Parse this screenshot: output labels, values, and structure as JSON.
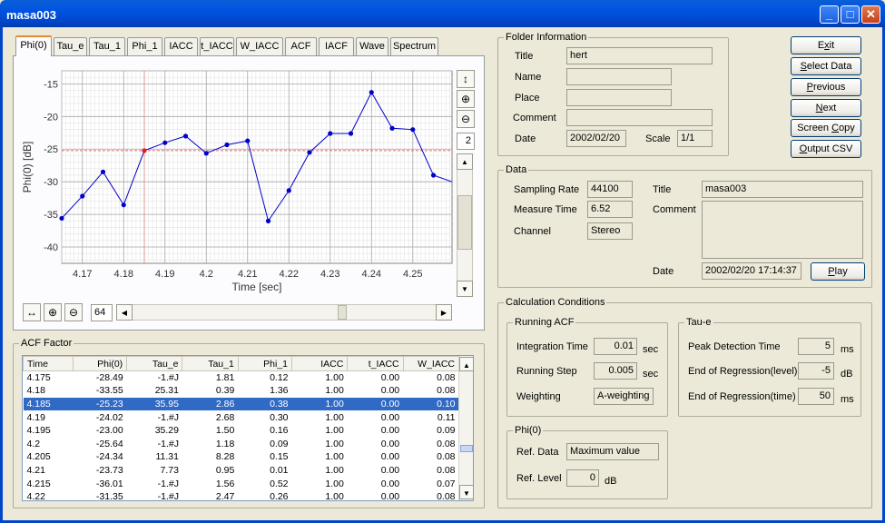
{
  "window": {
    "title": "masa003",
    "min_icon": "minimize-icon",
    "max_icon": "maximize-icon",
    "close_icon": "close-icon"
  },
  "tabs": [
    "Phi(0)",
    "Tau_e",
    "Tau_1",
    "Phi_1",
    "IACC",
    "t_IACC",
    "W_IACC",
    "ACF",
    "IACF",
    "Wave",
    "Spectrum"
  ],
  "active_tab": "Phi(0)",
  "chart_toolbar": {
    "value": "2",
    "zoom_value": "64"
  },
  "chart_data": {
    "type": "line",
    "xlabel": "Time [sec]",
    "ylabel": "Phi(0) [dB]",
    "x_ticks": [
      "4.17",
      "4.18",
      "4.19",
      "4.2",
      "4.21",
      "4.22",
      "4.23",
      "4.24",
      "4.25"
    ],
    "y_ticks": [
      "-15",
      "-20",
      "-25",
      "-30",
      "-35",
      "-40"
    ],
    "xlim": [
      4.165,
      4.2595
    ],
    "ylim": [
      -42.5,
      -13
    ],
    "grid": true,
    "reference_line": -25.23,
    "cursor_x": 4.185,
    "series": [
      {
        "color": "#0000C8",
        "x": [
          4.165,
          4.17,
          4.175,
          4.18,
          4.185,
          4.19,
          4.195,
          4.2,
          4.205,
          4.21,
          4.215,
          4.22,
          4.225,
          4.23,
          4.235,
          4.24,
          4.245,
          4.25,
          4.255,
          4.2595
        ],
        "y": [
          -35.6,
          -32.2,
          -28.49,
          -33.55,
          -25.23,
          -24.02,
          -23.0,
          -25.64,
          -24.34,
          -23.73,
          -36.01,
          -31.35,
          -25.5,
          -22.6,
          -22.6,
          -16.3,
          -21.8,
          -22.0,
          -29.0,
          -30.0
        ]
      }
    ],
    "highlight_index": 4
  },
  "acf_factor": {
    "title": "ACF Factor",
    "columns": [
      "Time",
      "Phi(0)",
      "Tau_e",
      "Tau_1",
      "Phi_1",
      "IACC",
      "t_IACC",
      "W_IACC"
    ],
    "rows": [
      [
        "4.175",
        "-28.49",
        "-1.#J",
        "1.81",
        "0.12",
        "1.00",
        "0.00",
        "0.08"
      ],
      [
        "4.18",
        "-33.55",
        "25.31",
        "0.39",
        "1.36",
        "1.00",
        "0.00",
        "0.08"
      ],
      [
        "4.185",
        "-25.23",
        "35.95",
        "2.86",
        "0.38",
        "1.00",
        "0.00",
        "0.10"
      ],
      [
        "4.19",
        "-24.02",
        "-1.#J",
        "2.68",
        "0.30",
        "1.00",
        "0.00",
        "0.11"
      ],
      [
        "4.195",
        "-23.00",
        "35.29",
        "1.50",
        "0.16",
        "1.00",
        "0.00",
        "0.09"
      ],
      [
        "4.2",
        "-25.64",
        "-1.#J",
        "1.18",
        "0.09",
        "1.00",
        "0.00",
        "0.08"
      ],
      [
        "4.205",
        "-24.34",
        "11.31",
        "8.28",
        "0.15",
        "1.00",
        "0.00",
        "0.08"
      ],
      [
        "4.21",
        "-23.73",
        "7.73",
        "0.95",
        "0.01",
        "1.00",
        "0.00",
        "0.08"
      ],
      [
        "4.215",
        "-36.01",
        "-1.#J",
        "1.56",
        "0.52",
        "1.00",
        "0.00",
        "0.07"
      ],
      [
        "4.22",
        "-31.35",
        "-1.#J",
        "2.47",
        "0.26",
        "1.00",
        "0.00",
        "0.08"
      ]
    ],
    "selected_row": 2
  },
  "folder_info": {
    "title": "Folder Information",
    "title_label": "Title",
    "title_value": "hert",
    "name_label": "Name",
    "name_value": "",
    "place_label": "Place",
    "place_value": "",
    "comment_label": "Comment",
    "comment_value": "",
    "date_label": "Date",
    "date_value": "2002/02/20",
    "scale_label": "Scale",
    "scale_value": "1/1"
  },
  "buttons": {
    "exit": "Exit",
    "select_data": "Select Data",
    "previous": "Previous",
    "next": "Next",
    "screen_copy": "Screen Copy",
    "output_csv": "Output CSV",
    "play": "Play"
  },
  "data": {
    "title": "Data",
    "sampling_rate_label": "Sampling Rate",
    "sampling_rate": "44100",
    "measure_time_label": "Measure Time",
    "measure_time": "6.52",
    "channel_label": "Channel",
    "channel": "Stereo",
    "title_label": "Title",
    "title_value": "masa003",
    "comment_label": "Comment",
    "comment_value": "",
    "date_label": "Date",
    "date_value": "2002/02/20 17:14:37"
  },
  "calc": {
    "title": "Calculation Conditions",
    "running_acf": {
      "title": "Running ACF",
      "integration_label": "Integration Time",
      "integration": "0.01",
      "integration_unit": "sec",
      "step_label": "Running Step",
      "step": "0.005",
      "step_unit": "sec",
      "weighting_label": "Weighting",
      "weighting": "A-weighting"
    },
    "tau_e": {
      "title": "Tau-e",
      "peak_label": "Peak Detection Time",
      "peak": "5",
      "peak_unit": "ms",
      "eor_level_label": "End of Regression(level)",
      "eor_level": "-5",
      "eor_level_unit": "dB",
      "eor_time_label": "End of Regression(time)",
      "eor_time": "50",
      "eor_time_unit": "ms"
    },
    "phi0": {
      "title": "Phi(0)",
      "ref_data_label": "Ref. Data",
      "ref_data": "Maximum value",
      "ref_level_label": "Ref. Level",
      "ref_level": "0",
      "ref_level_unit": "dB"
    }
  }
}
